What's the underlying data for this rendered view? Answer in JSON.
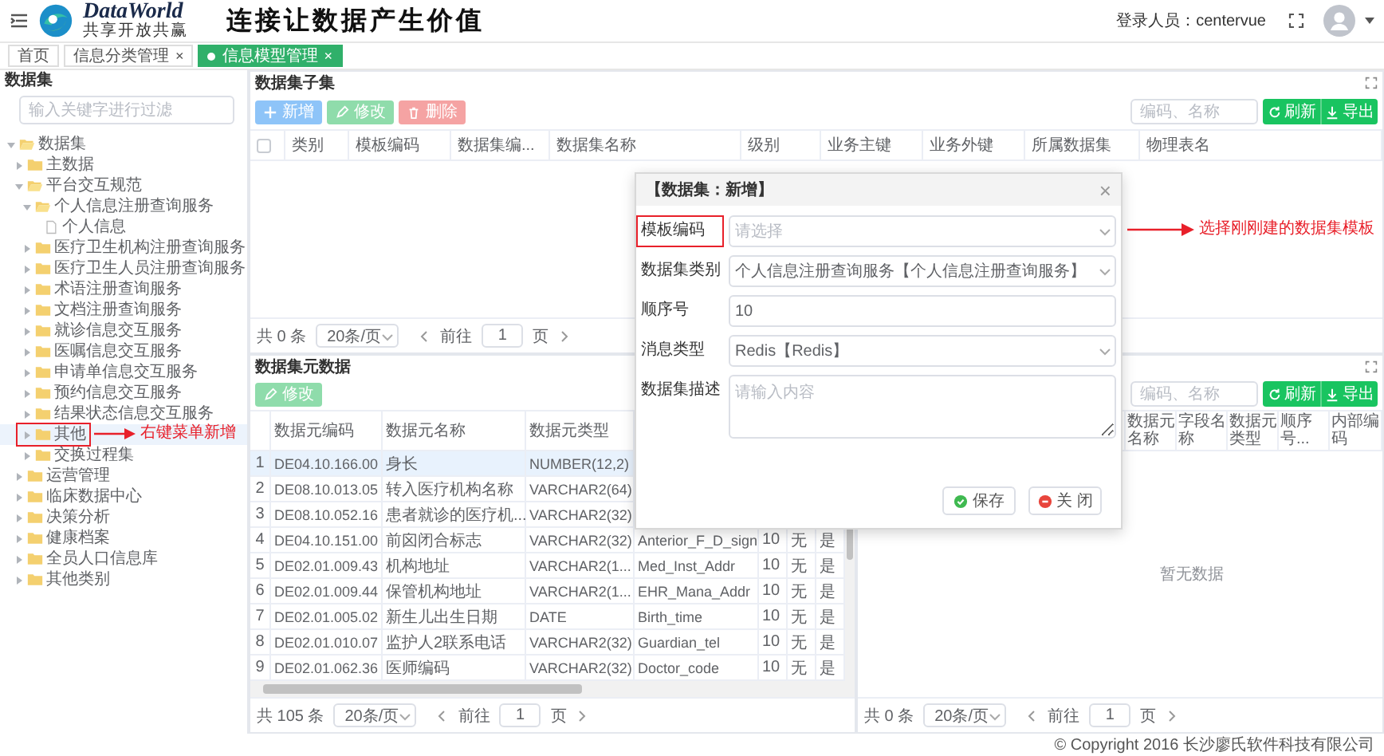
{
  "header": {
    "logo_title": "DataWorld",
    "logo_subtitle": "共享开放共赢",
    "slogan": "连接让数据产生价值",
    "user_label": "登录人员：centervue"
  },
  "tabs": [
    {
      "label": "首页",
      "selected": false
    },
    {
      "label": "信息分类管理",
      "selected": false,
      "close": "×"
    },
    {
      "label": "信息模型管理",
      "selected": true,
      "close": "×"
    }
  ],
  "sidebar": {
    "title": "数据集",
    "filter_placeholder": "输入关键字进行过滤",
    "tree": [
      {
        "label": "数据集",
        "kind": "folder",
        "expanded": true,
        "selected": false,
        "annotated": false,
        "children": [
          {
            "label": "主数据",
            "kind": "folder",
            "expanded": false,
            "selected": false,
            "annotated": false
          },
          {
            "label": "平台交互规范",
            "kind": "folder",
            "expanded": true,
            "selected": false,
            "annotated": false,
            "children": [
              {
                "label": "个人信息注册查询服务",
                "kind": "folder",
                "expanded": true,
                "selected": false,
                "annotated": false,
                "children": [
                  {
                    "label": "个人信息",
                    "kind": "file",
                    "selected": false,
                    "annotated": false
                  }
                ]
              },
              {
                "label": "医疗卫生机构注册查询服务",
                "kind": "folder",
                "expanded": false,
                "selected": false,
                "annotated": false
              },
              {
                "label": "医疗卫生人员注册查询服务",
                "kind": "folder",
                "expanded": false,
                "selected": false,
                "annotated": false
              },
              {
                "label": "术语注册查询服务",
                "kind": "folder",
                "expanded": false,
                "selected": false,
                "annotated": false
              },
              {
                "label": "文档注册查询服务",
                "kind": "folder",
                "expanded": false,
                "selected": false,
                "annotated": false
              },
              {
                "label": "就诊信息交互服务",
                "kind": "folder",
                "expanded": false,
                "selected": false,
                "annotated": false
              },
              {
                "label": "医嘱信息交互服务",
                "kind": "folder",
                "expanded": false,
                "selected": false,
                "annotated": false
              },
              {
                "label": "申请单信息交互服务",
                "kind": "folder",
                "expanded": false,
                "selected": false,
                "annotated": false
              },
              {
                "label": "预约信息交互服务",
                "kind": "folder",
                "expanded": false,
                "selected": false,
                "annotated": false
              },
              {
                "label": "结果状态信息交互服务",
                "kind": "folder",
                "expanded": false,
                "selected": false,
                "annotated": false
              },
              {
                "label": "其他",
                "kind": "folder",
                "expanded": false,
                "selected": true,
                "annotated": true
              },
              {
                "label": "交换过程集",
                "kind": "folder",
                "expanded": false,
                "selected": false,
                "annotated": false
              }
            ]
          },
          {
            "label": "运营管理",
            "kind": "folder",
            "expanded": false,
            "selected": false,
            "annotated": false
          },
          {
            "label": "临床数据中心",
            "kind": "folder",
            "expanded": false,
            "selected": false,
            "annotated": false
          },
          {
            "label": "决策分析",
            "kind": "folder",
            "expanded": false,
            "selected": false,
            "annotated": false
          },
          {
            "label": "健康档案",
            "kind": "folder",
            "expanded": false,
            "selected": false,
            "annotated": false
          },
          {
            "label": "全员人口信息库",
            "kind": "folder",
            "expanded": false,
            "selected": false,
            "annotated": false
          },
          {
            "label": "其他类别",
            "kind": "folder",
            "expanded": false,
            "selected": false,
            "annotated": false
          }
        ]
      }
    ]
  },
  "top_panel": {
    "title": "数据集子集",
    "toolbar": [
      {
        "label": "新增",
        "kind": "add"
      },
      {
        "label": "修改",
        "kind": "edit"
      },
      {
        "label": "删除",
        "kind": "delete"
      }
    ],
    "search_placeholder": "编码、名称",
    "actions": [
      {
        "label": "刷新",
        "kind": "refresh"
      },
      {
        "label": "导出",
        "kind": "export"
      }
    ],
    "select_all_checked": false,
    "columns": [
      "类别",
      "模板编码",
      "数据集编...",
      "数据集名称",
      "级别",
      "业务主键",
      "业务外键",
      "所属数据集",
      "物理表名"
    ],
    "pagination": {
      "total": "共 0 条",
      "page_size": "20条/页",
      "goto": "前往",
      "page": "1",
      "unit": "页"
    }
  },
  "bottom_left": {
    "title": "数据集元数据",
    "toolbar": [
      {
        "label": "修改",
        "kind": "edit"
      }
    ],
    "columns": [
      "数据元编码",
      "数据元名称",
      "数据元类型"
    ],
    "rows": [
      {
        "index": "1",
        "selected": true,
        "cells": [
          "DE04.10.166.00",
          "身长",
          "NUMBER(12,2)"
        ]
      },
      {
        "index": "2",
        "selected": false,
        "cells": [
          "DE08.10.013.05",
          "转入医疗机构名称",
          "VARCHAR2(64)"
        ]
      },
      {
        "index": "3",
        "selected": false,
        "cells": [
          "DE08.10.052.16",
          "患者就诊的医疗机...",
          "VARCHAR2(32)"
        ]
      },
      {
        "index": "4",
        "selected": false,
        "cells": [
          "DE04.10.151.00",
          "前囟闭合标志",
          "VARCHAR2(32)",
          "Anterior_F_D_sign",
          "10",
          "无",
          "是"
        ]
      },
      {
        "index": "5",
        "selected": false,
        "cells": [
          "DE02.01.009.43",
          "机构地址",
          "VARCHAR2(1...",
          "Med_Inst_Addr",
          "10",
          "无",
          "是"
        ]
      },
      {
        "index": "6",
        "selected": false,
        "cells": [
          "DE02.01.009.44",
          "保管机构地址",
          "VARCHAR2(1...",
          "EHR_Mana_Addr",
          "10",
          "无",
          "是"
        ]
      },
      {
        "index": "7",
        "selected": false,
        "cells": [
          "DE02.01.005.02",
          "新生儿出生日期",
          "DATE",
          "Birth_time",
          "10",
          "无",
          "是"
        ]
      },
      {
        "index": "8",
        "selected": false,
        "cells": [
          "DE02.01.010.07",
          "监护人2联系电话",
          "VARCHAR2(32)",
          "Guardian_tel",
          "10",
          "无",
          "是"
        ]
      },
      {
        "index": "9",
        "selected": false,
        "cells": [
          "DE02.01.062.36",
          "医师编码",
          "VARCHAR2(32)",
          "Doctor_code",
          "10",
          "无",
          "是"
        ]
      }
    ],
    "pagination": {
      "total": "共 105 条",
      "page_size": "20条/页",
      "goto": "前往",
      "page": "1",
      "unit": "页"
    }
  },
  "bottom_right": {
    "search_placeholder": "编码、名称",
    "actions": [
      {
        "label": "刷新",
        "kind": "refresh"
      },
      {
        "label": "导出",
        "kind": "export"
      }
    ],
    "columns": [
      "数据元名称",
      "字段名称",
      "数据元类型",
      "顺序号...",
      "内部编码"
    ],
    "empty_text": "暂无数据",
    "pagination": {
      "total": "共 0 条",
      "page_size": "20条/页",
      "goto": "前往",
      "page": "1",
      "unit": "页"
    }
  },
  "dialog": {
    "title": "【数据集：新增】",
    "close": "×",
    "fields": [
      {
        "label": "模板编码",
        "kind": "select",
        "placeholder": "请选择",
        "annotated": true
      },
      {
        "label": "数据集类别",
        "kind": "select",
        "value": "个人信息注册查询服务【个人信息注册查询服务】",
        "annotated": false
      },
      {
        "label": "顺序号",
        "kind": "input",
        "value": "10",
        "annotated": false
      },
      {
        "label": "消息类型",
        "kind": "select",
        "value": "Redis【Redis】",
        "annotated": false
      },
      {
        "label": "数据集描述",
        "kind": "textarea",
        "placeholder": "请输入内容",
        "annotated": false
      }
    ],
    "buttons": [
      {
        "label": "保存",
        "kind": "save"
      },
      {
        "label": "关 闭",
        "kind": "close"
      }
    ]
  },
  "annotations": [
    {
      "text": "右键菜单新增"
    },
    {
      "text": "选择刚刚建的数据集模板"
    }
  ],
  "footer": {
    "copyright": "© Copyright 2016 长沙廖氏软件科技有限公司"
  }
}
